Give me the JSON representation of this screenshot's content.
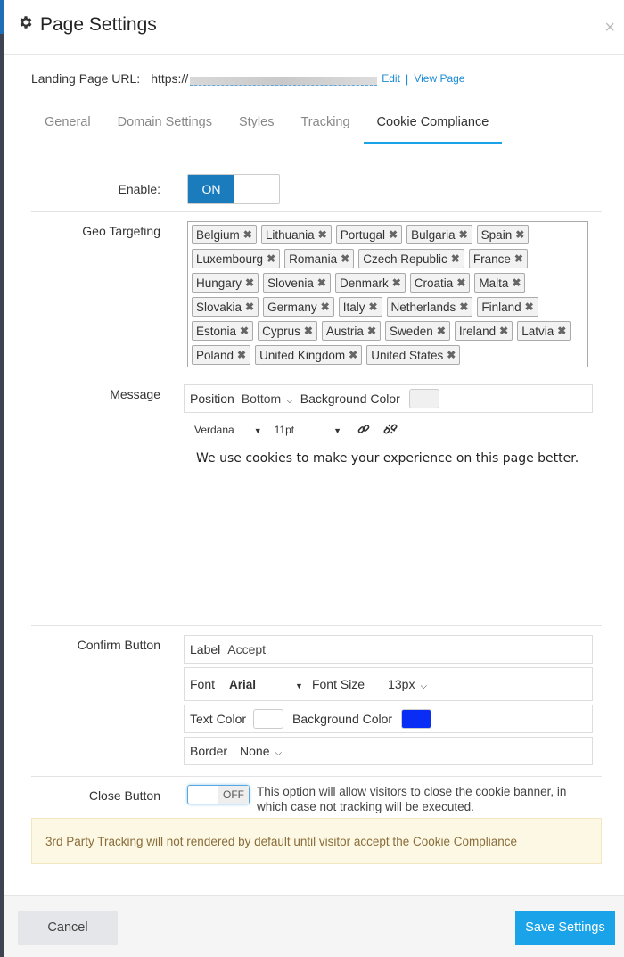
{
  "header": {
    "title": "Page Settings",
    "close_glyph": "×"
  },
  "url": {
    "label": "Landing Page URL:",
    "prefix": "https://",
    "edit_link": "Edit",
    "separator": "|",
    "view_link": "View Page"
  },
  "tabs": [
    {
      "label": "General"
    },
    {
      "label": "Domain Settings"
    },
    {
      "label": "Styles"
    },
    {
      "label": "Tracking"
    },
    {
      "label": "Cookie Compliance",
      "active": true
    }
  ],
  "enable": {
    "label": "Enable:",
    "toggle_text": "ON"
  },
  "geo": {
    "label": "Geo Targeting",
    "rows": [
      [
        "Belgium",
        "Lithuania",
        "Portugal",
        "Bulgaria",
        "Spain"
      ],
      [
        "Luxembourg",
        "Romania",
        "Czech Republic",
        "France"
      ],
      [
        "Hungary",
        "Slovenia",
        "Denmark",
        "Croatia",
        "Malta"
      ],
      [
        "Slovakia",
        "Germany",
        "Italy",
        "Netherlands",
        "Finland"
      ],
      [
        "Estonia",
        "Cyprus",
        "Austria",
        "Sweden",
        "Ireland",
        "Latvia"
      ],
      [
        "Poland",
        "United Kingdom",
        "United States"
      ]
    ]
  },
  "message": {
    "label": "Message",
    "position_label": "Position",
    "position_value": "Bottom",
    "bg_label": "Background Color",
    "font_family": "Verdana",
    "font_size": "11pt",
    "text": "We use cookies to make your experience on this page better."
  },
  "confirm": {
    "label": "Confirm Button",
    "label_label": "Label",
    "label_value": "Accept",
    "font_label": "Font",
    "font_value": "Arial",
    "font_size_label": "Font Size",
    "font_size_value": "13px",
    "text_color_label": "Text Color",
    "bg_color_label": "Background Color",
    "border_label": "Border",
    "border_value": "None"
  },
  "close_button": {
    "label": "Close Button",
    "toggle_text": "OFF",
    "description": "This option will allow visitors to close the cookie banner, in which case not tracking will be executed."
  },
  "notice": "3rd Party Tracking will not rendered by default until visitor accept the Cookie Compliance",
  "footer": {
    "cancel": "Cancel",
    "save": "Save Settings"
  },
  "colors": {
    "accent": "#1aa3e8",
    "toggle_on": "#1a7cbd",
    "confirm_bg": "#0a2df5",
    "message_bg": "#f0f0f0"
  }
}
